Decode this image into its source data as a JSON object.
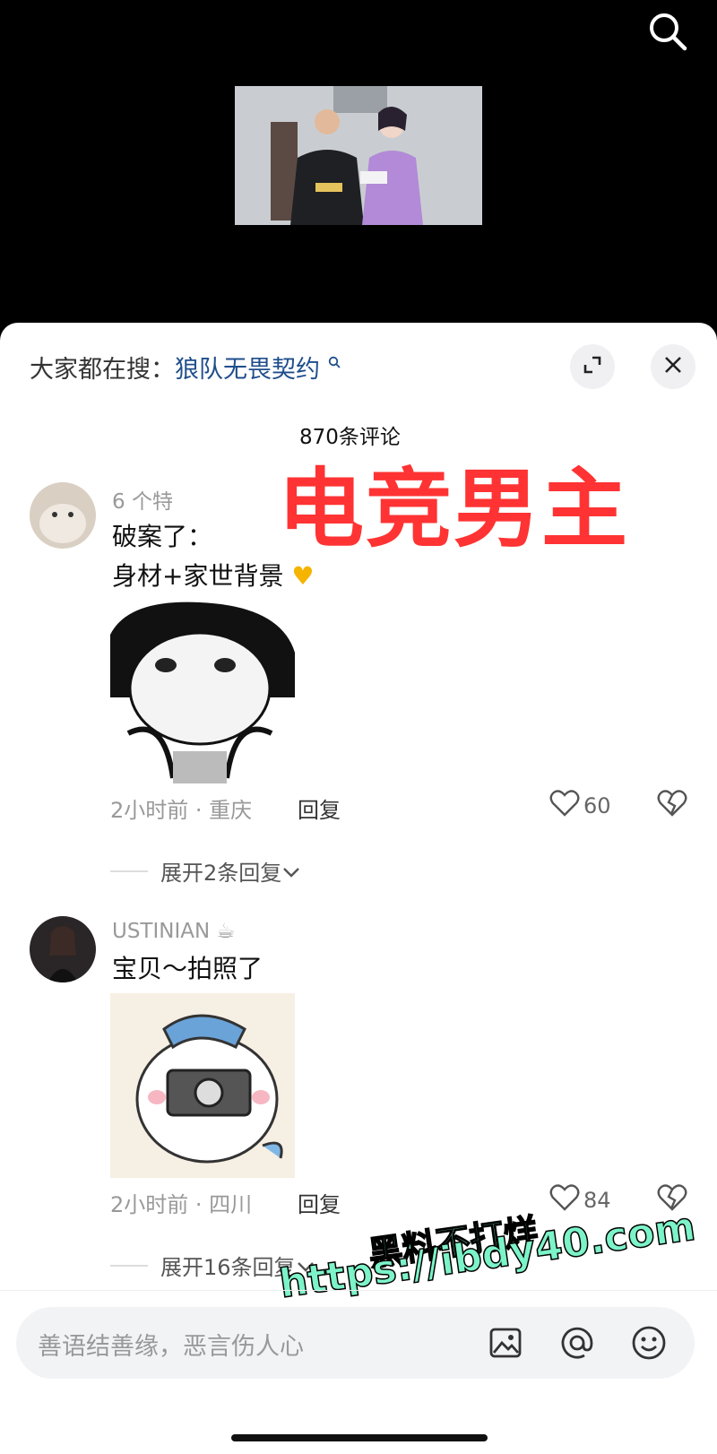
{
  "header": {
    "hot_search_prefix": "大家都在搜：",
    "hot_search_keyword": "狼队无畏契约",
    "comment_count": "870条评论",
    "overlay_title": "电竞男主"
  },
  "comments": [
    {
      "user": "6 个特",
      "text1": "破案了：",
      "text2": "身材+家世背景",
      "meta": "2小时前 · 重庆",
      "reply_label": "回复",
      "likes": "60",
      "expand": "展开2条回复"
    },
    {
      "user": "USTINIAN",
      "text1": "宝贝～拍照了",
      "meta": "2小时前 · 四川",
      "reply_label": "回复",
      "likes": "84",
      "expand": "展开16条回复"
    }
  ],
  "input": {
    "placeholder": "善语结善缘，恶言伤人心"
  },
  "watermark": {
    "line1": "黑料不打烊",
    "line2": "https://ibdy40.com"
  },
  "icons": [
    "search-icon",
    "fullscreen-icon",
    "close-icon",
    "heart-icon",
    "dislike-icon",
    "image-icon",
    "at-icon",
    "emoji-icon",
    "chevron-down-icon"
  ],
  "colors": {
    "title_red": "#ff3333",
    "link_blue": "#1f4e8c",
    "watermark_green": "#7cf3c8"
  }
}
